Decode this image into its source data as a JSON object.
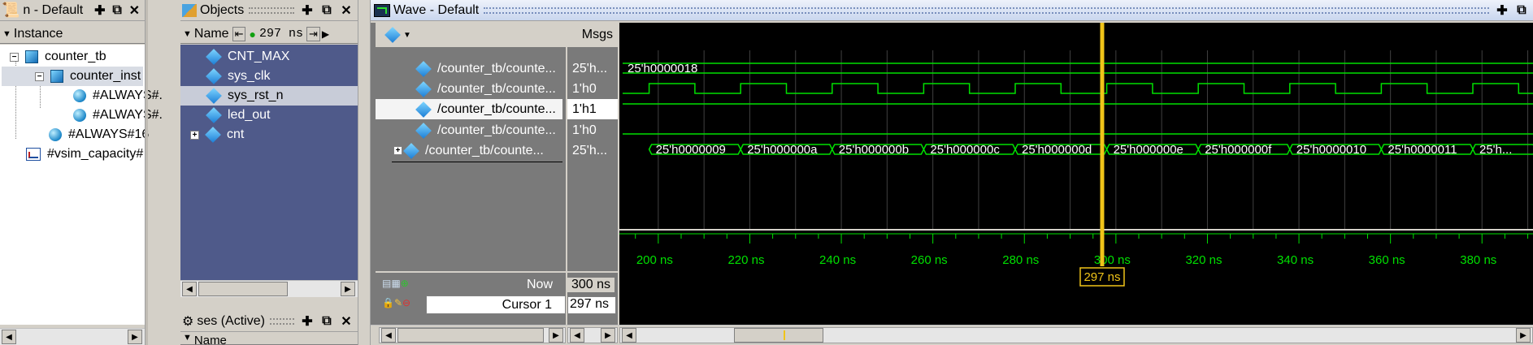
{
  "instance_pane": {
    "title": "n - Default",
    "header": "Instance",
    "tree": [
      {
        "label": "counter_tb"
      },
      {
        "label": "counter_inst"
      },
      {
        "label": "#ALWAYS#."
      },
      {
        "label": "#ALWAYS#."
      },
      {
        "label": "#ALWAYS#16"
      },
      {
        "label": "#vsim_capacity#"
      }
    ]
  },
  "objects_pane": {
    "title": "Objects",
    "col_name": "Name",
    "time_value": "297 ns",
    "items": [
      {
        "label": "CNT_MAX"
      },
      {
        "label": "sys_clk"
      },
      {
        "label": "sys_rst_n"
      },
      {
        "label": "led_out"
      },
      {
        "label": "cnt"
      }
    ]
  },
  "processes_pane": {
    "title": "ses (Active)",
    "col_name": "Name"
  },
  "wave_pane": {
    "title": "Wave - Default",
    "msgs_header": "Msgs",
    "signals": [
      {
        "name": "/counter_tb/counte...",
        "value": "25'h..."
      },
      {
        "name": "/counter_tb/counte...",
        "value": "1'h0"
      },
      {
        "name": "/counter_tb/counte...",
        "value": "1'h1"
      },
      {
        "name": "/counter_tb/counte...",
        "value": "1'h0"
      },
      {
        "name": "/counter_tb/counte...",
        "value": "25'h..."
      }
    ],
    "const_value": "25'h0000018",
    "bus_values": [
      "25'h0000009",
      "25'h000000a",
      "25'h000000b",
      "25'h000000c",
      "25'h000000d",
      "25'h000000e",
      "25'h000000f",
      "25'h0000010",
      "25'h0000011",
      "25'h..."
    ],
    "now_label": "Now",
    "now_value": "300 ns",
    "cursor_label": "Cursor 1",
    "cursor_value": "297 ns",
    "cursor_time_ns": 297,
    "cursor_tag": "297 ns",
    "timeline_labels": [
      "200 ns",
      "220 ns",
      "240 ns",
      "260 ns",
      "280 ns",
      "300 ns",
      "320 ns",
      "340 ns",
      "360 ns",
      "380 ns"
    ],
    "colors": {
      "wave": "#00e000",
      "cursor": "#f0c419",
      "background": "#000000",
      "grid": "#404040"
    }
  }
}
